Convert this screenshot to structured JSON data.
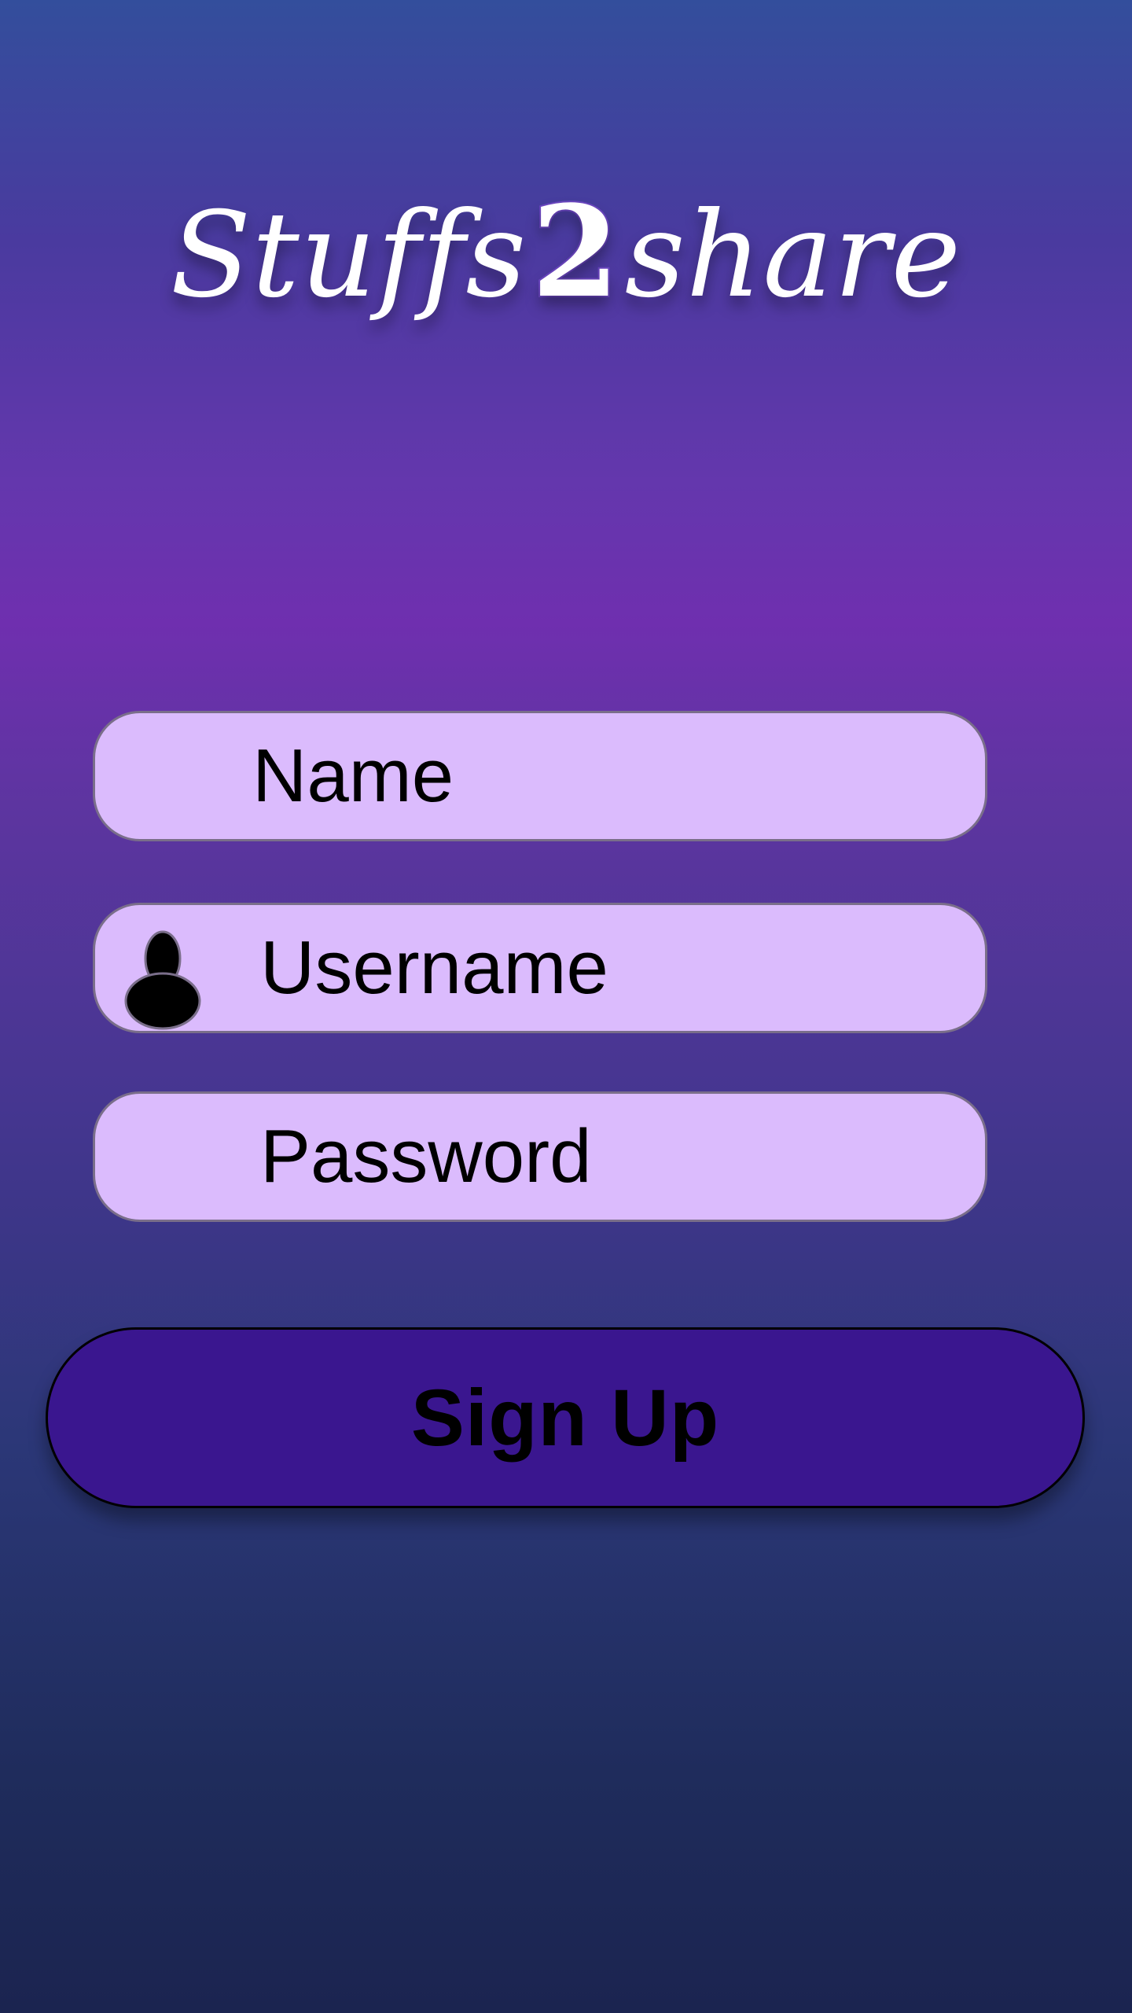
{
  "app": {
    "logo_part1": "Stuffs",
    "logo_part2": "2",
    "logo_part3": "share"
  },
  "form": {
    "name_placeholder": "Name",
    "username_placeholder": "Username",
    "password_placeholder": "Password",
    "signup_label": "Sign Up",
    "username_icon": "user-icon"
  },
  "colors": {
    "field_bg": "#dbbbfd",
    "button_bg": "#3a168f",
    "gradient_top": "#334e9c",
    "gradient_mid": "#6f2faf",
    "gradient_bottom": "#1b2450"
  }
}
